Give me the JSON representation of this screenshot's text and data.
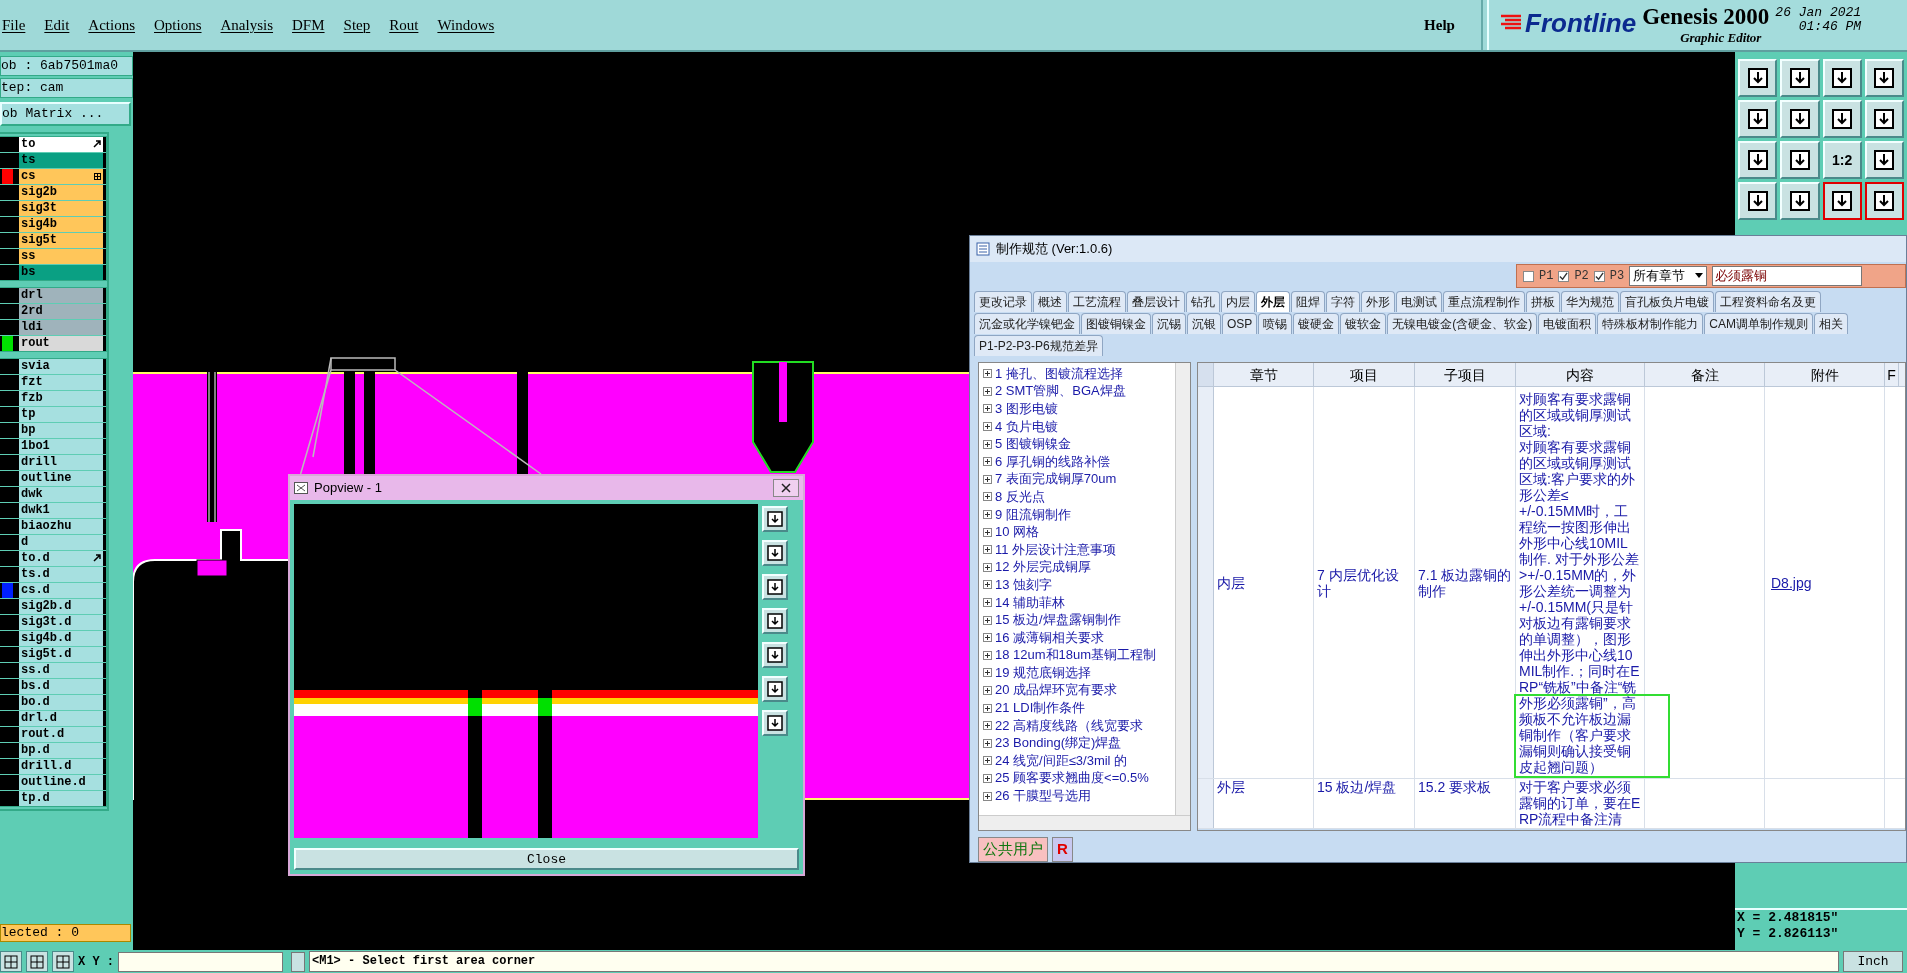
{
  "menu": {
    "items": [
      "File",
      "Edit",
      "Actions",
      "Options",
      "Analysis",
      "DFM",
      "Step",
      "Rout",
      "Windows"
    ],
    "help": "Help"
  },
  "brand": {
    "logo": "Frontline",
    "product": "Genesis 2000",
    "subtitle": "Graphic Editor",
    "date": "26 Jan 2021",
    "time": "01:46 PM"
  },
  "job_panel": {
    "job": "ob : 6ab7501ma0",
    "step": "tep: cam",
    "matrix_button": "ob Matrix ...",
    "layer_groups": [
      [
        {
          "name": "to",
          "kind": "silk",
          "pinned": true,
          "boxed": false
        },
        {
          "name": "ts",
          "kind": "mask",
          "pinned": false,
          "boxed": false
        },
        {
          "name": "cs",
          "kind": "signal",
          "pinned": false,
          "boxed": true,
          "color": "#ff0000"
        },
        {
          "name": "sig2b",
          "kind": "signal",
          "pinned": false,
          "boxed": false
        },
        {
          "name": "sig3t",
          "kind": "signal",
          "pinned": false,
          "boxed": false
        },
        {
          "name": "sig4b",
          "kind": "signal",
          "pinned": false,
          "boxed": false
        },
        {
          "name": "sig5t",
          "kind": "signal",
          "pinned": false,
          "boxed": false
        },
        {
          "name": "ss",
          "kind": "signal",
          "pinned": false,
          "boxed": false
        },
        {
          "name": "bs",
          "kind": "mask",
          "pinned": false,
          "boxed": false
        }
      ],
      [
        {
          "name": "drl",
          "kind": "drill",
          "pinned": false,
          "boxed": false
        },
        {
          "name": "2rd",
          "kind": "drill",
          "pinned": false,
          "boxed": false
        },
        {
          "name": "ldi",
          "kind": "drill",
          "pinned": false,
          "boxed": false
        },
        {
          "name": "rout",
          "kind": "rout",
          "pinned": false,
          "boxed": false,
          "color": "#00e000"
        }
      ],
      [
        {
          "name": "svia",
          "kind": "misc",
          "pinned": false,
          "boxed": false
        },
        {
          "name": "fzt",
          "kind": "misc",
          "pinned": false,
          "boxed": false
        },
        {
          "name": "fzb",
          "kind": "misc",
          "pinned": false,
          "boxed": false
        },
        {
          "name": "tp",
          "kind": "misc",
          "pinned": false,
          "boxed": false
        },
        {
          "name": "bp",
          "kind": "misc",
          "pinned": false,
          "boxed": false
        },
        {
          "name": "1bo1",
          "kind": "misc",
          "pinned": false,
          "boxed": false
        },
        {
          "name": "drill",
          "kind": "misc",
          "pinned": false,
          "boxed": false
        },
        {
          "name": "outline",
          "kind": "misc",
          "pinned": false,
          "boxed": false
        },
        {
          "name": "dwk",
          "kind": "misc",
          "pinned": false,
          "boxed": false
        },
        {
          "name": "dwk1",
          "kind": "misc",
          "pinned": false,
          "boxed": false
        },
        {
          "name": "biaozhu",
          "kind": "misc",
          "pinned": false,
          "boxed": false
        },
        {
          "name": "d",
          "kind": "misc",
          "pinned": false,
          "boxed": false
        },
        {
          "name": "to.d",
          "kind": "misc",
          "pinned": true,
          "boxed": false
        },
        {
          "name": "ts.d",
          "kind": "misc",
          "pinned": false,
          "boxed": false
        },
        {
          "name": "cs.d",
          "kind": "misc",
          "pinned": false,
          "boxed": false,
          "color": "#0020ff"
        },
        {
          "name": "sig2b.d",
          "kind": "misc",
          "pinned": false,
          "boxed": false
        },
        {
          "name": "sig3t.d",
          "kind": "misc",
          "pinned": false,
          "boxed": false
        },
        {
          "name": "sig4b.d",
          "kind": "misc",
          "pinned": false,
          "boxed": false
        },
        {
          "name": "sig5t.d",
          "kind": "misc",
          "pinned": false,
          "boxed": false
        },
        {
          "name": "ss.d",
          "kind": "misc",
          "pinned": false,
          "boxed": false
        },
        {
          "name": "bs.d",
          "kind": "misc",
          "pinned": false,
          "boxed": false
        },
        {
          "name": "bo.d",
          "kind": "misc",
          "pinned": false,
          "boxed": false
        },
        {
          "name": "drl.d",
          "kind": "misc",
          "pinned": false,
          "boxed": false
        },
        {
          "name": "rout.d",
          "kind": "misc",
          "pinned": false,
          "boxed": false
        },
        {
          "name": "bp.d",
          "kind": "misc",
          "pinned": false,
          "boxed": false
        },
        {
          "name": "drill.d",
          "kind": "misc",
          "pinned": false,
          "boxed": false
        },
        {
          "name": "outline.d",
          "kind": "misc",
          "pinned": false,
          "boxed": false
        },
        {
          "name": "tp.d",
          "kind": "misc",
          "pinned": false,
          "boxed": false
        }
      ]
    ],
    "selected_count": "lected : 0"
  },
  "toolbar": [
    {
      "kind": "icon",
      "highlighted": false
    },
    {
      "kind": "icon",
      "highlighted": false
    },
    {
      "kind": "icon",
      "highlighted": false
    },
    {
      "kind": "icon",
      "highlighted": false
    },
    {
      "kind": "icon",
      "highlighted": false
    },
    {
      "kind": "icon",
      "highlighted": false
    },
    {
      "kind": "icon",
      "highlighted": false
    },
    {
      "kind": "icon",
      "highlighted": false
    },
    {
      "kind": "icon",
      "highlighted": false
    },
    {
      "kind": "icon",
      "highlighted": false
    },
    {
      "kind": "label",
      "label": "1:2",
      "highlighted": false
    },
    {
      "kind": "icon",
      "highlighted": false
    },
    {
      "kind": "icon",
      "highlighted": false
    },
    {
      "kind": "icon",
      "highlighted": false
    },
    {
      "kind": "icon",
      "highlighted": true
    },
    {
      "kind": "icon",
      "highlighted": true
    }
  ],
  "coordinates": {
    "x": "X = 2.481815\"",
    "y": "Y = 2.826113\""
  },
  "popview": {
    "title": "Popview - 1",
    "close_button": "Close"
  },
  "dialog": {
    "title": "制作规范 (Ver:1.0.6)",
    "filters": [
      {
        "label": "P1",
        "checked": false
      },
      {
        "label": "P2",
        "checked": true
      },
      {
        "label": "P3",
        "checked": true
      }
    ],
    "chapter_select": "所有章节",
    "search": {
      "value": "必须露铜"
    },
    "tab_rows": [
      [
        {
          "label": "更改记录",
          "selected": false
        },
        {
          "label": "概述",
          "selected": false
        },
        {
          "label": "工艺流程",
          "selected": false
        },
        {
          "label": "叠层设计",
          "selected": false
        },
        {
          "label": "钻孔",
          "selected": false
        },
        {
          "label": "内层",
          "selected": false
        },
        {
          "label": "外层",
          "selected": true
        },
        {
          "label": "阻焊",
          "selected": false
        },
        {
          "label": "字符",
          "selected": false
        },
        {
          "label": "外形",
          "selected": false
        },
        {
          "label": "电测试",
          "selected": false
        },
        {
          "label": "重点流程制作",
          "selected": false
        },
        {
          "label": "拼板",
          "selected": false
        },
        {
          "label": "华为规范",
          "selected": false
        },
        {
          "label": "盲孔板负片电镀",
          "selected": false
        },
        {
          "label": "工程资料命名及更",
          "selected": false
        }
      ],
      [
        {
          "label": "沉金或化学镍钯金",
          "selected": false
        },
        {
          "label": "图镀铜镍金",
          "selected": false
        },
        {
          "label": "沉锡",
          "selected": false
        },
        {
          "label": "沉银",
          "selected": false
        },
        {
          "label": "OSP",
          "selected": false
        },
        {
          "label": "喷锡",
          "selected": false
        },
        {
          "label": "镀硬金",
          "selected": false
        },
        {
          "label": "镀软金",
          "selected": false
        },
        {
          "label": "无镍电镀金(含硬金、软金)",
          "selected": false
        },
        {
          "label": "电镀面积",
          "selected": false
        },
        {
          "label": "特殊板材制作能力",
          "selected": false
        },
        {
          "label": "CAM调单制作规则",
          "selected": false
        },
        {
          "label": "相关",
          "selected": false
        }
      ],
      [
        {
          "label": "P1-P2-P3-P6规范差异",
          "selected": false
        }
      ]
    ],
    "tree": [
      {
        "label": "1 掩孔、图镀流程选择",
        "expanded": false
      },
      {
        "label": "2 SMT管脚、BGA焊盘",
        "expanded": false
      },
      {
        "label": "3 图形电镀",
        "expanded": false
      },
      {
        "label": "4 负片电镀",
        "expanded": false
      },
      {
        "label": "5 图镀铜镍金",
        "expanded": false
      },
      {
        "label": "6 厚孔铜的线路补偿",
        "expanded": false
      },
      {
        "label": "7 表面完成铜厚70um",
        "expanded": false
      },
      {
        "label": "8 反光点",
        "expanded": false
      },
      {
        "label": "9 阻流铜制作",
        "expanded": false
      },
      {
        "label": "10 网格",
        "expanded": false
      },
      {
        "label": "11 外层设计注意事项",
        "expanded": false
      },
      {
        "label": "12 外层完成铜厚",
        "expanded": false
      },
      {
        "label": "13 蚀刻字",
        "expanded": false
      },
      {
        "label": "14 辅助菲林",
        "expanded": false
      },
      {
        "label": "15 板边/焊盘露铜制作",
        "expanded": false
      },
      {
        "label": "16 减薄铜相关要求",
        "expanded": false
      },
      {
        "label": "18 12um和18um基铜工程制",
        "expanded": false
      },
      {
        "label": "19 规范底铜选择",
        "expanded": false
      },
      {
        "label": "20 成品焊环宽有要求",
        "expanded": false
      },
      {
        "label": "21 LDI制作条件",
        "expanded": false
      },
      {
        "label": "22 高精度线路（线宽要求",
        "expanded": false
      },
      {
        "label": "23 Bonding(绑定)焊盘",
        "expanded": false
      },
      {
        "label": "24 线宽/间距≤3/3mil 的",
        "expanded": false
      },
      {
        "label": "25 顾客要求翘曲度<=0.5%",
        "expanded": false
      },
      {
        "label": "26 干膜型号选用",
        "expanded": false
      }
    ],
    "table": {
      "columns": [
        "章节",
        "项目",
        "子项目",
        "内容",
        "备注",
        "附件",
        "F"
      ],
      "rows": [
        {
          "cells": [
            "内层",
            "7 内层优化设计",
            "7.1 板边露铜的制作",
            "对顾客有要求露铜的区域或铜厚测试区域:\n对顾客有要求露铜的区域或铜厚测试区域:客户要求的外形公差≤\n+/-0.15MM时，工程统一按图形伸出外形中心线10MIL制作. 对于外形公差>+/-0.15MM的，外形公差统一调整为\n+/-0.15MM(只是针对板边有露铜要求的单调整），图形伸出外形中心线10MIL制作.；同时在ERP“铣板”中备注“铣外形必须露铜”，高频板不允许板边漏铜制作（客户要求漏铜则确认接受铜皮起翘问题）",
            "",
            "D8.jpg"
          ],
          "highlighted": true
        },
        {
          "cells": [
            "外层",
            "15 板边/焊盘",
            "15.2 要求板",
            "对于客户要求必须露铜的订单，要在ERP流程中备注清",
            "",
            ""
          ],
          "highlighted": false
        }
      ]
    },
    "user": "公共用户",
    "user_badge": "R"
  },
  "status": {
    "xy_label": "X Y :",
    "message": "<M1> - Select first area corner",
    "units": "Inch"
  }
}
